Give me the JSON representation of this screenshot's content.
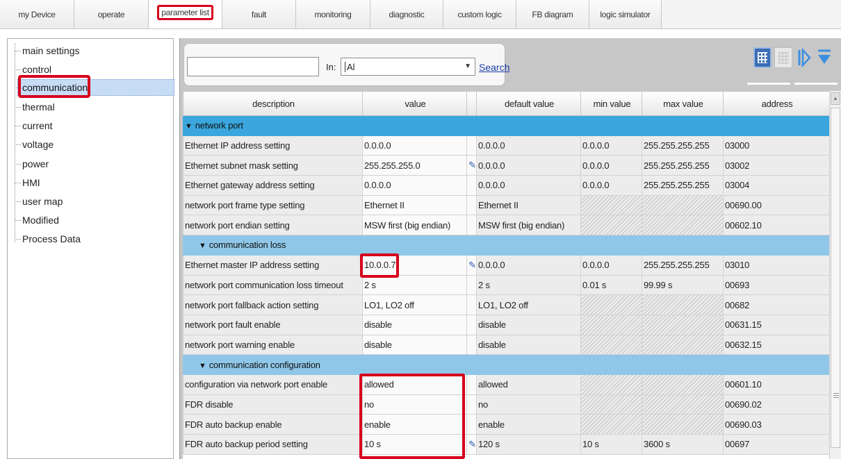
{
  "tabs": [
    {
      "label": "my Device"
    },
    {
      "label": "operate"
    },
    {
      "label": "parameter list"
    },
    {
      "label": "fault"
    },
    {
      "label": "monitoring"
    },
    {
      "label": "diagnostic"
    },
    {
      "label": "custom logic"
    },
    {
      "label": "FB diagram"
    },
    {
      "label": "logic simulator"
    }
  ],
  "tree": {
    "items": [
      {
        "label": "main settings"
      },
      {
        "label": "control"
      },
      {
        "label": "communication"
      },
      {
        "label": "thermal"
      },
      {
        "label": "current"
      },
      {
        "label": "voltage"
      },
      {
        "label": "power"
      },
      {
        "label": "HMI"
      },
      {
        "label": "user map"
      },
      {
        "label": "Modified"
      },
      {
        "label": "Process Data"
      }
    ],
    "selected": "communication"
  },
  "search": {
    "value": "",
    "in_label": "In:",
    "in_value": "Al",
    "button_label": "Search"
  },
  "columns": {
    "description": "description",
    "value": "value",
    "default_value": "default value",
    "min_value": "min value",
    "max_value": "max value",
    "address": "address"
  },
  "groups": {
    "network_port": "network port",
    "communication_loss": "communication loss",
    "communication_configuration": "communication configuration"
  },
  "rows": [
    {
      "description": "Ethernet IP address setting",
      "value": "0.0.0.0",
      "default": "0.0.0.0",
      "min": "0.0.0.0",
      "max": "255.255.255.255",
      "address": "03000"
    },
    {
      "description": "Ethernet subnet mask setting",
      "value": "255.255.255.0",
      "default": "0.0.0.0",
      "min": "0.0.0.0",
      "max": "255.255.255.255",
      "address": "03002"
    },
    {
      "description": "Ethernet gateway address setting",
      "value": "0.0.0.0",
      "default": "0.0.0.0",
      "min": "0.0.0.0",
      "max": "255.255.255.255",
      "address": "03004"
    },
    {
      "description": "network port frame type setting",
      "value": "Ethernet II",
      "default": "Ethernet II",
      "min": "",
      "max": "",
      "address": "00690.00"
    },
    {
      "description": "network port endian setting",
      "value": "MSW first (big endian)",
      "default": "MSW first (big endian)",
      "min": "",
      "max": "",
      "address": "00602.10"
    },
    {
      "description": "Ethernet master IP address setting",
      "value": "10.0.0.7",
      "default": "0.0.0.0",
      "min": "0.0.0.0",
      "max": "255.255.255.255",
      "address": "03010"
    },
    {
      "description": "network port communication loss timeout",
      "value": "2 s",
      "default": "2 s",
      "min": "0.01 s",
      "max": "99.99 s",
      "address": "00693"
    },
    {
      "description": "network port fallback action setting",
      "value": "LO1, LO2 off",
      "default": "LO1, LO2 off",
      "min": "",
      "max": "",
      "address": "00682"
    },
    {
      "description": "network port fault enable",
      "value": "disable",
      "default": "disable",
      "min": "",
      "max": "",
      "address": "00631.15"
    },
    {
      "description": "network port warning enable",
      "value": "disable",
      "default": "disable",
      "min": "",
      "max": "",
      "address": "00632.15"
    },
    {
      "description": "configuration via network port enable",
      "value": "allowed",
      "default": "allowed",
      "min": "",
      "max": "",
      "address": "00601.10"
    },
    {
      "description": "FDR disable",
      "value": "no",
      "default": "no",
      "min": "",
      "max": "",
      "address": "00690.02"
    },
    {
      "description": "FDR auto backup enable",
      "value": "enable",
      "default": "enable",
      "min": "",
      "max": "",
      "address": "00690.03"
    },
    {
      "description": "FDR auto backup period setting",
      "value": "10 s",
      "default": "120 s",
      "min": "10 s",
      "max": "3600 s",
      "address": "00697"
    }
  ],
  "icons": {
    "edit": "pencil-icon",
    "expand_all": "expand-all-icon",
    "collapse_all": "collapse-all-icon",
    "table_view": "table-view-icon",
    "grid_view": "grid-view-icon"
  },
  "colors": {
    "highlight": "#d6001c",
    "group_header": "#3aa6dd",
    "subgroup_header": "#8fc7e8",
    "link": "#1a3ea8"
  }
}
